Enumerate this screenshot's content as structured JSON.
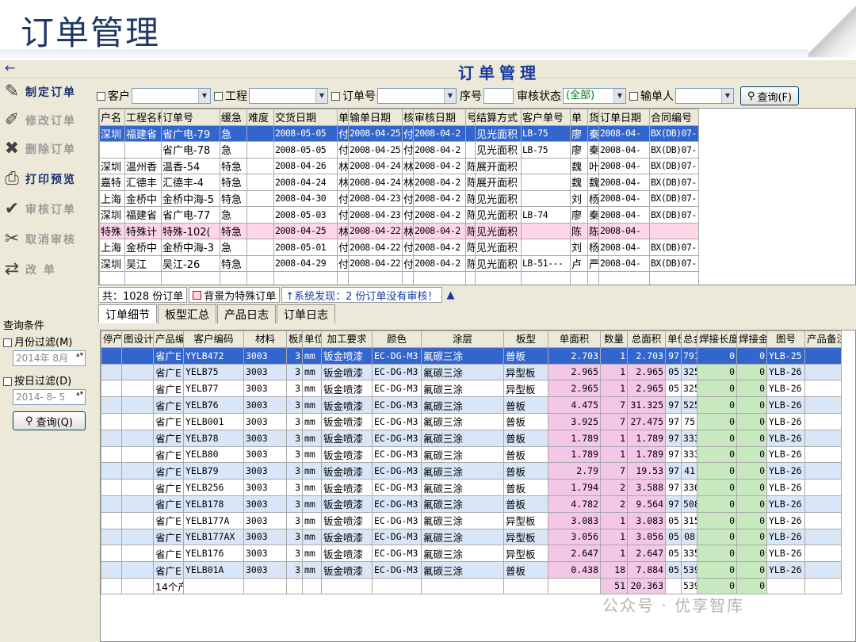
{
  "slide": {
    "title": "订单管理"
  },
  "app": {
    "title": "订单管理",
    "back_icon": "←"
  },
  "sidebar": {
    "items": [
      {
        "label": "制定订单",
        "icon": "✎",
        "enabled": true
      },
      {
        "label": "修改订单",
        "icon": "✐",
        "enabled": false
      },
      {
        "label": "删除订单",
        "icon": "✖",
        "enabled": false
      },
      {
        "label": "打印预览",
        "icon": "⎙",
        "enabled": true
      },
      {
        "label": "审核订单",
        "icon": "✔",
        "enabled": false
      },
      {
        "label": "取消审核",
        "icon": "✂",
        "enabled": false
      },
      {
        "label": "改    单",
        "icon": "⇄",
        "enabled": false
      }
    ],
    "filter": {
      "title": "查询条件",
      "month_label": "月份过滤(M)",
      "month_value": "2014年 8月",
      "day_label": "按日过滤(D)",
      "day_value": "2014- 8- 5",
      "query_button": "查询(Q)"
    }
  },
  "toolbar": {
    "customer_label": "客户",
    "project_label": "工程",
    "order_no_label": "订单号",
    "seq_label": "序号",
    "audit_label": "审核状态",
    "audit_value": "(全部)",
    "entry_label": "输单人",
    "query_button": "查询(F)"
  },
  "orders": {
    "headers": [
      "户名",
      "工程名称",
      "订单号",
      "缓急",
      "难度",
      "交货日期",
      "单",
      "输单日期",
      "核",
      "审核日期",
      "号",
      "结算方式",
      "客户单号",
      "单",
      "货",
      "订单日期",
      "合同编号"
    ],
    "rows": [
      [
        "深圳",
        "福建省",
        "省广电-79",
        "急",
        "",
        "2008-05-05",
        "付",
        "2008-04-25",
        "付",
        "2008-04-2",
        "",
        "见光面积",
        "LB-75",
        "廖",
        "秦",
        "2008-04-",
        "BX(DB)07-"
      ],
      [
        "",
        "",
        "省广电-78",
        "急",
        "",
        "2008-05-05",
        "付",
        "2008-04-25",
        "付",
        "2008-04-2",
        "",
        "见光面积",
        "LB-75",
        "廖",
        "秦",
        "2008-04-",
        "BX(DB)07-"
      ],
      [
        "深圳",
        "温州香",
        "温香-54",
        "特急",
        "",
        "2008-04-26",
        "林",
        "2008-04-24",
        "林",
        "2008-04-2",
        "陈",
        "展开面积",
        "",
        "魏",
        "叶",
        "2008-04-",
        "BX(DB)07-"
      ],
      [
        "嘉特",
        "汇德丰",
        "汇德丰-4",
        "特急",
        "",
        "2008-04-24",
        "林",
        "2008-04-24",
        "林",
        "2008-04-2",
        "陈",
        "展开面积",
        "",
        "魏",
        "魏",
        "2008-04-",
        "BX(DB)07-"
      ],
      [
        "上海",
        "金桥中",
        "金桥中海-5",
        "特急",
        "",
        "2008-04-30",
        "付",
        "2008-04-23",
        "付",
        "2008-04-2",
        "陈",
        "见光面积",
        "",
        "刘",
        "杨",
        "2008-04-",
        "BX(DB)07-"
      ],
      [
        "深圳",
        "福建省",
        "省广电-77",
        "急",
        "",
        "2008-05-03",
        "付",
        "2008-04-23",
        "付",
        "2008-04-2",
        "陈",
        "见光面积",
        "LB-74",
        "廖",
        "秦",
        "2008-04-",
        "BX(DB)07-"
      ],
      [
        "特殊",
        "特殊计",
        "特殊-102(",
        "特急",
        "",
        "2008-04-25",
        "林",
        "2008-04-22",
        "林",
        "2008-04-2",
        "陈",
        "见光面积",
        "",
        "陈",
        "陈",
        "2008-04-",
        ""
      ],
      [
        "上海",
        "金桥中",
        "金桥中海-3",
        "急",
        "",
        "2008-05-01",
        "付",
        "2008-04-22",
        "付",
        "2008-04-2",
        "陈",
        "见光面积",
        "",
        "刘",
        "杨",
        "2008-04-",
        "BX(DB)07-"
      ],
      [
        "深圳",
        "吴江",
        "吴江-26",
        "特急",
        "",
        "2008-04-29",
        "付",
        "2008-04-22",
        "付",
        "2008-04-2",
        "陈",
        "见光面积",
        "LB-51---",
        "卢",
        "严",
        "2008-04-",
        "BX(DB)07-"
      ]
    ]
  },
  "status": {
    "total": "共：1028 份订单",
    "legend": "背景为特殊订单",
    "alert": "↑系统发现：2 份订单没有审核！",
    "arrow": "▲"
  },
  "tabs": [
    "订单细节",
    "板型汇总",
    "产品日志",
    "订单日志"
  ],
  "details": {
    "headers": [
      "停产",
      "图设计人",
      "产品编码",
      "客户编码",
      "材料",
      "板厚",
      "单位",
      "加工要求",
      "颜色",
      "涂层",
      "板型",
      "单面积",
      "数量",
      "总面积",
      "单价(元",
      "总金额",
      "焊接长度",
      "焊接金额",
      "图号",
      "产品备注"
    ],
    "rows": [
      [
        "",
        "",
        "省广E",
        "YYLB472",
        "3003",
        "3",
        "mm",
        "钣金喷漆",
        "EC-DG-M3",
        "氟碳三涂",
        "普板",
        "2.703",
        "1",
        "2.703",
        "97",
        "791",
        "0",
        "0",
        "YLB-25",
        ""
      ],
      [
        "",
        "",
        "省广E",
        "YELB75",
        "3003",
        "3",
        "mm",
        "钣金喷漆",
        "EC-DG-M3",
        "氟碳三涂",
        "异型板",
        "2.965",
        "1",
        "2.965",
        "05",
        "325",
        "0",
        "0",
        "YLB-26",
        ""
      ],
      [
        "",
        "",
        "省广E",
        "YELB77",
        "3003",
        "3",
        "mm",
        "钣金喷漆",
        "EC-DG-M3",
        "氟碳三涂",
        "异型板",
        "2.965",
        "1",
        "2.965",
        "05",
        "325",
        "0",
        "0",
        "YLB-26",
        ""
      ],
      [
        "",
        "",
        "省广E",
        "YELB76",
        "3003",
        "3",
        "mm",
        "钣金喷漆",
        "EC-DG-M3",
        "氟碳三涂",
        "普板",
        "4.475",
        "7",
        "31.325",
        "97",
        "525",
        "0",
        "0",
        "YLB-26",
        ""
      ],
      [
        "",
        "",
        "省广E",
        "YELB001",
        "3003",
        "3",
        "mm",
        "钣金喷漆",
        "EC-DG-M3",
        "氟碳三涂",
        "普板",
        "3.925",
        "7",
        "27.475",
        "97",
        "75",
        "0",
        "0",
        "YLB-26",
        ""
      ],
      [
        "",
        "",
        "省广E",
        "YELB78",
        "3003",
        "3",
        "mm",
        "钣金喷漆",
        "EC-DG-M3",
        "氟碳三涂",
        "普板",
        "1.789",
        "1",
        "1.789",
        "97",
        "333",
        "0",
        "0",
        "YLB-26",
        ""
      ],
      [
        "",
        "",
        "省广E",
        "YELB80",
        "3003",
        "3",
        "mm",
        "钣金喷漆",
        "EC-DG-M3",
        "氟碳三涂",
        "普板",
        "1.789",
        "1",
        "1.789",
        "97",
        "333",
        "0",
        "0",
        "YLB-26",
        ""
      ],
      [
        "",
        "",
        "省广E",
        "YELB79",
        "3003",
        "3",
        "mm",
        "钣金喷漆",
        "EC-DG-M3",
        "氟碳三涂",
        "普板",
        "2.79",
        "7",
        "19.53",
        "97",
        "41",
        "0",
        "0",
        "YLB-26",
        ""
      ],
      [
        "",
        "",
        "省广E",
        "YELB256",
        "3003",
        "3",
        "mm",
        "钣金喷漆",
        "EC-DG-M3",
        "氟碳三涂",
        "普板",
        "1.794",
        "2",
        "3.588",
        "97",
        "336",
        "0",
        "0",
        "YLB-26",
        ""
      ],
      [
        "",
        "",
        "省广E",
        "YELB178",
        "3003",
        "3",
        "mm",
        "钣金喷漆",
        "EC-DG-M3",
        "氟碳三涂",
        "普板",
        "4.782",
        "2",
        "9.564",
        "97",
        "508",
        "0",
        "0",
        "YLB-26",
        ""
      ],
      [
        "",
        "",
        "省广E",
        "YELB177A",
        "3003",
        "3",
        "mm",
        "钣金喷漆",
        "EC-DG-M3",
        "氟碳三涂",
        "异型板",
        "3.083",
        "1",
        "3.083",
        "05",
        "315",
        "0",
        "0",
        "YLB-26",
        ""
      ],
      [
        "",
        "",
        "省广E",
        "YELB177AX",
        "3003",
        "3",
        "mm",
        "钣金喷漆",
        "EC-DG-M3",
        "氟碳三涂",
        "异型板",
        "3.056",
        "1",
        "3.056",
        "05",
        "08",
        "0",
        "0",
        "YLB-26",
        ""
      ],
      [
        "",
        "",
        "省广E",
        "YELB176",
        "3003",
        "3",
        "mm",
        "钣金喷漆",
        "EC-DG-M3",
        "氟碳三涂",
        "异型板",
        "2.647",
        "1",
        "2.647",
        "05",
        "335",
        "0",
        "0",
        "YLB-26",
        ""
      ],
      [
        "",
        "",
        "省广E",
        "YELB01A",
        "3003",
        "3",
        "mm",
        "钣金喷漆",
        "EC-DG-M3",
        "氟碳三涂",
        "普板",
        "0.438",
        "18",
        "7.884",
        "05",
        "539",
        "0",
        "0",
        "YLB-26",
        ""
      ]
    ],
    "totals": {
      "count_label": "14个产",
      "quantity": "51",
      "area": "20.363",
      "amount": "539",
      "weld_length": "0",
      "weld_amount": "0"
    }
  },
  "watermark": "公众号 · 优享智库"
}
